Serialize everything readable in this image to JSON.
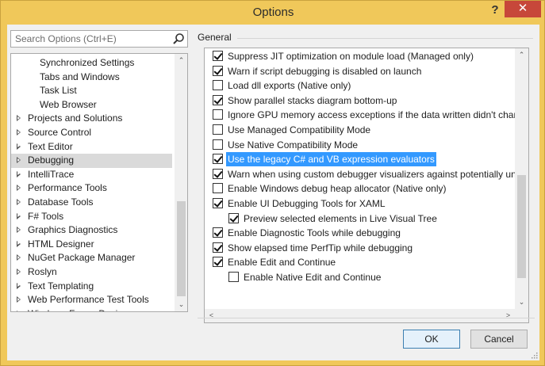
{
  "window": {
    "title": "Options",
    "help_label": "?",
    "close_label": "✕"
  },
  "search": {
    "placeholder": "Search Options (Ctrl+E)"
  },
  "tree": {
    "items": [
      {
        "label": "Synchronized Settings",
        "level": "child"
      },
      {
        "label": "Tabs and Windows",
        "level": "child"
      },
      {
        "label": "Task List",
        "level": "child"
      },
      {
        "label": "Web Browser",
        "level": "child"
      },
      {
        "label": "Projects and Solutions",
        "level": "parent"
      },
      {
        "label": "Source Control",
        "level": "parent"
      },
      {
        "label": "Text Editor",
        "level": "parent"
      },
      {
        "label": "Debugging",
        "level": "parent",
        "selected": true
      },
      {
        "label": "IntelliTrace",
        "level": "parent"
      },
      {
        "label": "Performance Tools",
        "level": "parent"
      },
      {
        "label": "Database Tools",
        "level": "parent"
      },
      {
        "label": "F# Tools",
        "level": "parent"
      },
      {
        "label": "Graphics Diagnostics",
        "level": "parent"
      },
      {
        "label": "HTML Designer",
        "level": "parent"
      },
      {
        "label": "NuGet Package Manager",
        "level": "parent"
      },
      {
        "label": "Roslyn",
        "level": "parent"
      },
      {
        "label": "Text Templating",
        "level": "parent"
      },
      {
        "label": "Web Performance Test Tools",
        "level": "parent"
      },
      {
        "label": "Windows Forms Designer",
        "level": "parent"
      }
    ]
  },
  "general": {
    "section_label": "General",
    "options": [
      {
        "label": "Suppress JIT optimization on module load (Managed only)",
        "checked": true,
        "indent": 0
      },
      {
        "label": "Warn if script debugging is disabled on launch",
        "checked": true,
        "indent": 0
      },
      {
        "label": "Load dll exports (Native only)",
        "checked": false,
        "indent": 0
      },
      {
        "label": "Show parallel stacks diagram bottom-up",
        "checked": true,
        "indent": 0
      },
      {
        "label": "Ignore GPU memory access exceptions if the data written didn't chan",
        "checked": false,
        "indent": 0
      },
      {
        "label": "Use Managed Compatibility Mode",
        "checked": false,
        "indent": 0
      },
      {
        "label": "Use Native Compatibility Mode",
        "checked": false,
        "indent": 0
      },
      {
        "label": "Use the legacy C# and VB expression evaluators",
        "checked": true,
        "indent": 0,
        "selected": true
      },
      {
        "label": "Warn when using custom debugger visualizers against potentially uns",
        "checked": true,
        "indent": 0
      },
      {
        "label": "Enable Windows debug heap allocator (Native only)",
        "checked": false,
        "indent": 0
      },
      {
        "label": "Enable UI Debugging Tools for XAML",
        "checked": true,
        "indent": 0
      },
      {
        "label": "Preview selected elements in Live Visual Tree",
        "checked": true,
        "indent": 1
      },
      {
        "label": "Enable Diagnostic Tools while debugging",
        "checked": true,
        "indent": 0
      },
      {
        "label": "Show elapsed time PerfTip while debugging",
        "checked": true,
        "indent": 0
      },
      {
        "label": "Enable Edit and Continue",
        "checked": true,
        "indent": 0
      },
      {
        "label": "Enable Native Edit and Continue",
        "checked": false,
        "indent": 1
      }
    ]
  },
  "buttons": {
    "ok_label": "OK",
    "cancel_label": "Cancel"
  }
}
